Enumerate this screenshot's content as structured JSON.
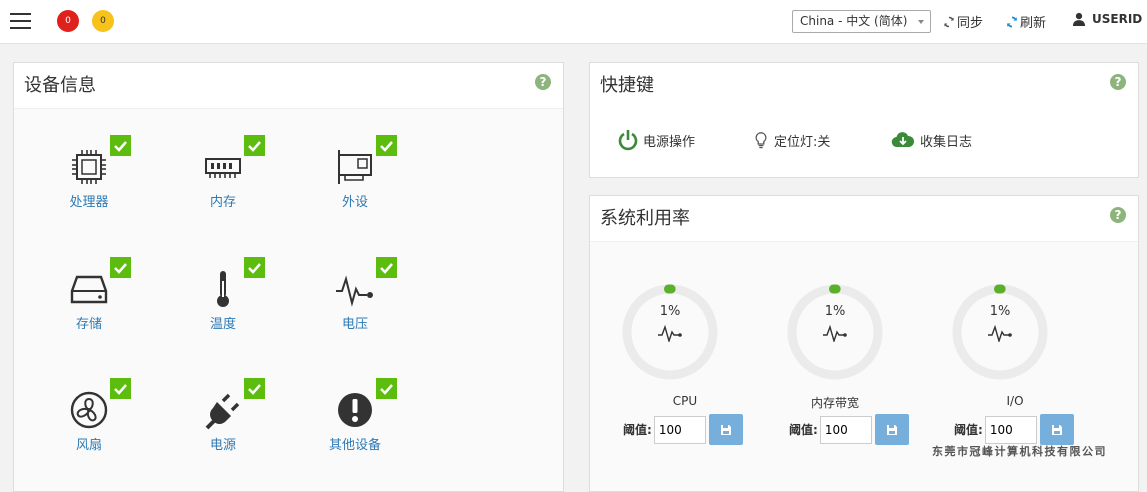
{
  "header": {
    "badge_red": "0",
    "badge_yellow": "0",
    "language": "China - 中文 (简体)",
    "sync_label": "同步",
    "refresh_label": "刷新",
    "user_label": "USERID"
  },
  "device_panel": {
    "title": "设备信息",
    "items": [
      {
        "label": "处理器",
        "icon": "cpu-icon",
        "status": "ok"
      },
      {
        "label": "内存",
        "icon": "memory-icon",
        "status": "ok"
      },
      {
        "label": "外设",
        "icon": "pci-card-icon",
        "status": "ok"
      },
      {
        "label": "存储",
        "icon": "storage-icon",
        "status": "ok"
      },
      {
        "label": "温度",
        "icon": "thermometer-icon",
        "status": "ok"
      },
      {
        "label": "电压",
        "icon": "voltage-icon",
        "status": "ok"
      },
      {
        "label": "风扇",
        "icon": "fan-icon",
        "status": "ok"
      },
      {
        "label": "电源",
        "icon": "power-plug-icon",
        "status": "ok"
      },
      {
        "label": "其他设备",
        "icon": "exclamation-icon",
        "status": "ok"
      }
    ]
  },
  "shortcut_panel": {
    "title": "快捷键",
    "items": [
      {
        "label": "电源操作",
        "icon": "power-icon"
      },
      {
        "label": "定位灯:关",
        "icon": "lightbulb-icon"
      },
      {
        "label": "收集日志",
        "icon": "cloud-download-icon"
      }
    ]
  },
  "util_panel": {
    "title": "系统利用率",
    "threshold_label": "阈值:",
    "gauges": [
      {
        "name": "CPU",
        "value": "1%",
        "percent": 1,
        "threshold": "100"
      },
      {
        "name": "内存带宽",
        "value": "1%",
        "percent": 1,
        "threshold": "100"
      },
      {
        "name": "I/O",
        "value": "1%",
        "percent": 1,
        "threshold": "100"
      }
    ]
  },
  "colors": {
    "ok_green": "#5cbd0f",
    "gauge_fill": "#5ab02a",
    "gauge_track": "#ebebeb",
    "link_blue": "#2d7ab5",
    "save_button": "#76aedc"
  },
  "footer": {
    "company": "东莞市冠峰计算机科技有限公司"
  }
}
